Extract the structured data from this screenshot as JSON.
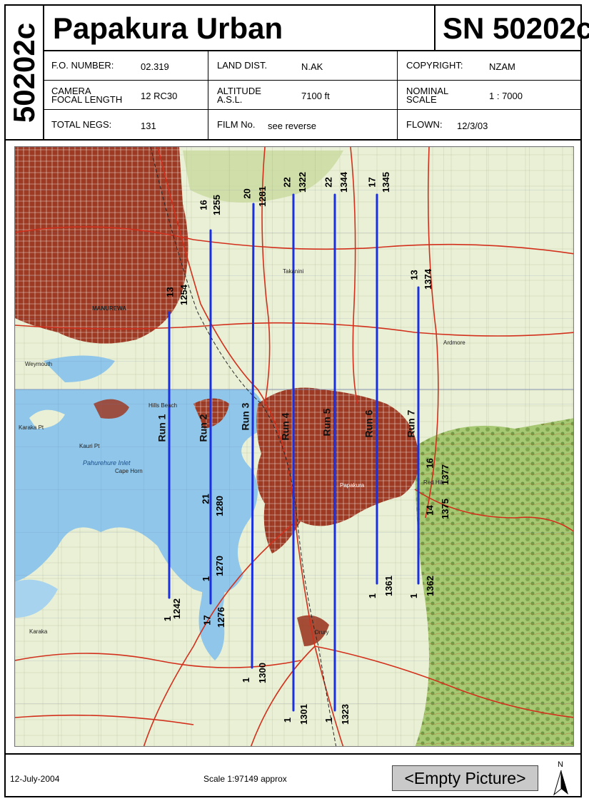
{
  "header": {
    "side_code": "50202c",
    "title": "Papakura Urban",
    "sn": "SN 50202c",
    "rows": [
      [
        {
          "label": "F.O. NUMBER:",
          "value": "02.319"
        },
        {
          "label": "LAND DIST.",
          "value": "N.AK"
        },
        {
          "label": "COPYRIGHT:",
          "value": "NZAM"
        }
      ],
      [
        {
          "label": "CAMERA FOCAL LENGTH",
          "label_l1": "CAMERA",
          "label_l2": "FOCAL LENGTH",
          "value": "12 RC30"
        },
        {
          "label": "ALTITUDE A.S.L.",
          "label_l1": "ALTITUDE",
          "label_l2": "A.S.L.",
          "value": "7100 ft"
        },
        {
          "label": "NOMINAL SCALE",
          "label_l1": "NOMINAL",
          "label_l2": "SCALE",
          "value": "1 : 7000"
        }
      ],
      [
        {
          "label": "TOTAL NEGS:",
          "value": "131"
        },
        {
          "label": "FILM No.",
          "value": "see reverse"
        },
        {
          "label": "FLOWN:",
          "value": "12/3/03"
        }
      ]
    ]
  },
  "map": {
    "places": [
      "MANUREWA",
      "Weymouth",
      "Karaka Pt",
      "Cape Horn",
      "Pahurehure Inlet",
      "Kauri Pt",
      "Hills Beach",
      "Papakura",
      "Drury",
      "Karaka",
      "Ardmore",
      "Red Hill",
      "Takanini"
    ],
    "runs": [
      {
        "name": "Run 1",
        "start_film": "13",
        "start_frame": "1254",
        "end_film": "1",
        "end_frame": "1242"
      },
      {
        "name": "Run 2",
        "start_film": "16",
        "start_frame": "1255",
        "mid_film": "21",
        "mid_frame": "1280",
        "mid2_film": "1",
        "mid2_frame": "1270",
        "end_film": "17",
        "end_frame": "1276"
      },
      {
        "name": "Run 3",
        "start_film": "20",
        "start_frame": "1281",
        "end_film": "1",
        "end_frame": "1300"
      },
      {
        "name": "Run 4",
        "start_film": "22",
        "start_frame": "1322",
        "end_film": "1",
        "end_frame": "1301"
      },
      {
        "name": "Run 5",
        "start_film": "22",
        "start_frame": "1344",
        "end_film": "1",
        "end_frame": "1323"
      },
      {
        "name": "Run 6",
        "start_film": "17",
        "start_frame": "1345",
        "end_film": "1",
        "end_frame": "1361"
      },
      {
        "name": "Run 7",
        "start_film": "13",
        "start_frame": "1374",
        "mid_film": "16",
        "mid_frame": "1377",
        "mid2_film": "14",
        "mid2_frame": "1375",
        "end_film": "1",
        "end_frame": "1362"
      }
    ],
    "run_color": "#1a2fe0",
    "land_color": "#e9f0d5",
    "water_color": "#8fc6ea",
    "urban_color": "#9c3a24",
    "road_color": "#d2301c",
    "bush_color": "#8fb85c"
  },
  "footer": {
    "date": "12-July-2004",
    "scale": "Scale  1:97149 approx",
    "empty_picture": "<Empty Picture>",
    "north_label": "N"
  }
}
